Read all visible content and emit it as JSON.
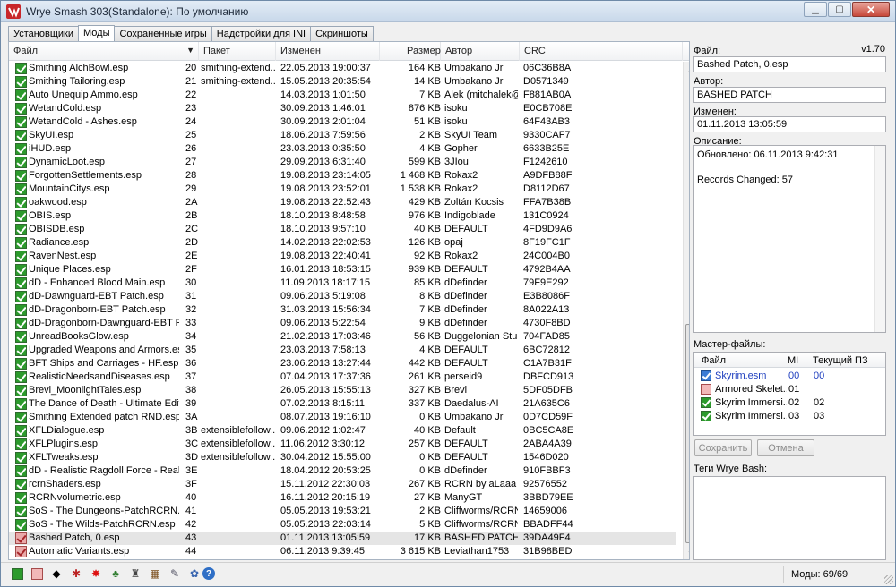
{
  "window": {
    "title": "Wrye Smash 303(Standalone): По умолчанию"
  },
  "tabs": [
    {
      "label": "Установщики",
      "active": false
    },
    {
      "label": "Моды",
      "active": true
    },
    {
      "label": "Сохраненные игры",
      "active": false
    },
    {
      "label": "Надстройки для INI",
      "active": false
    },
    {
      "label": "Скриншоты",
      "active": false
    }
  ],
  "mod_list": {
    "columns": {
      "file": "Файл",
      "package": "Пакет",
      "modified": "Изменен",
      "size": "Размер",
      "author": "Автор",
      "crc": "CRC"
    },
    "rows": [
      {
        "file": "Smithing AlchBowl.esp",
        "idx": "20",
        "package": "smithing-extend...",
        "date": "22.05.2013 19:00:37",
        "size": "164 KB",
        "author": "Umbakano Jr",
        "crc": "06C36B8A",
        "check": "on",
        "selected": false
      },
      {
        "file": "Smithing Tailoring.esp",
        "idx": "21",
        "package": "smithing-extend...",
        "date": "15.05.2013 20:35:54",
        "size": "14 KB",
        "author": "Umbakano Jr",
        "crc": "D0571349",
        "check": "on",
        "selected": false
      },
      {
        "file": "Auto Unequip Ammo.esp",
        "idx": "22",
        "package": "",
        "date": "14.03.2013 1:01:50",
        "size": "7 KB",
        "author": "Alek (mitchalek@...",
        "crc": "F881AB0A",
        "check": "on",
        "selected": false
      },
      {
        "file": "WetandCold.esp",
        "idx": "23",
        "package": "",
        "date": "30.09.2013 1:46:01",
        "size": "876 KB",
        "author": "isoku",
        "crc": "E0CB708E",
        "check": "on",
        "selected": false
      },
      {
        "file": "WetandCold - Ashes.esp",
        "idx": "24",
        "package": "",
        "date": "30.09.2013 2:01:04",
        "size": "51 KB",
        "author": "isoku",
        "crc": "64F43AB3",
        "check": "on",
        "selected": false
      },
      {
        "file": "SkyUI.esp",
        "idx": "25",
        "package": "",
        "date": "18.06.2013 7:59:56",
        "size": "2 KB",
        "author": "SkyUI Team",
        "crc": "9330CAF7",
        "check": "on",
        "selected": false
      },
      {
        "file": "iHUD.esp",
        "idx": "26",
        "package": "",
        "date": "23.03.2013 0:35:50",
        "size": "4 KB",
        "author": "Gopher",
        "crc": "6633B25E",
        "check": "on",
        "selected": false
      },
      {
        "file": "DynamicLoot.esp",
        "idx": "27",
        "package": "",
        "date": "29.09.2013 6:31:40",
        "size": "599 KB",
        "author": "3JIou",
        "crc": "F1242610",
        "check": "on",
        "selected": false
      },
      {
        "file": "ForgottenSettlements.esp",
        "idx": "28",
        "package": "",
        "date": "19.08.2013 23:14:05",
        "size": "1 468 KB",
        "author": "Rokax2",
        "crc": "A9DFB88F",
        "check": "on",
        "selected": false
      },
      {
        "file": "MountainCitys.esp",
        "idx": "29",
        "package": "",
        "date": "19.08.2013 23:52:01",
        "size": "1 538 KB",
        "author": "Rokax2",
        "crc": "D8112D67",
        "check": "on",
        "selected": false
      },
      {
        "file": "oakwood.esp",
        "idx": "2A",
        "package": "",
        "date": "19.08.2013 22:52:43",
        "size": "429 KB",
        "author": "Zoltán Kocsis",
        "crc": "FFA7B38B",
        "check": "on",
        "selected": false
      },
      {
        "file": "OBIS.esp",
        "idx": "2B",
        "package": "",
        "date": "18.10.2013 8:48:58",
        "size": "976 KB",
        "author": "Indigoblade",
        "crc": "131C0924",
        "check": "on",
        "selected": false
      },
      {
        "file": "OBISDB.esp",
        "idx": "2C",
        "package": "",
        "date": "18.10.2013 9:57:10",
        "size": "40 KB",
        "author": "DEFAULT",
        "crc": "4FD9D9A6",
        "check": "on",
        "selected": false
      },
      {
        "file": "Radiance.esp",
        "idx": "2D",
        "package": "",
        "date": "14.02.2013 22:02:53",
        "size": "126 KB",
        "author": "opaj",
        "crc": "8F19FC1F",
        "check": "on",
        "selected": false
      },
      {
        "file": "RavenNest.esp",
        "idx": "2E",
        "package": "",
        "date": "19.08.2013 22:40:41",
        "size": "92 KB",
        "author": "Rokax2",
        "crc": "24C004B0",
        "check": "on",
        "selected": false
      },
      {
        "file": "Unique Places.esp",
        "idx": "2F",
        "package": "",
        "date": "16.01.2013 18:53:15",
        "size": "939 KB",
        "author": "DEFAULT",
        "crc": "4792B4AA",
        "check": "on",
        "selected": false
      },
      {
        "file": "dD - Enhanced Blood Main.esp",
        "idx": "30",
        "package": "",
        "date": "11.09.2013 18:17:15",
        "size": "85 KB",
        "author": "dDefinder",
        "crc": "79F9E292",
        "check": "on",
        "selected": false
      },
      {
        "file": "dD-Dawnguard-EBT Patch.esp",
        "idx": "31",
        "package": "",
        "date": "09.06.2013 5:19:08",
        "size": "8 KB",
        "author": "dDefinder",
        "crc": "E3B8086F",
        "check": "on",
        "selected": false
      },
      {
        "file": "dD-Dragonborn-EBT Patch.esp",
        "idx": "32",
        "package": "",
        "date": "31.03.2013 15:56:34",
        "size": "7 KB",
        "author": "dDefinder",
        "crc": "8A022A13",
        "check": "on",
        "selected": false
      },
      {
        "file": "dD-Dragonborn-Dawnguard-EBT P...",
        "idx": "33",
        "package": "",
        "date": "09.06.2013 5:22:54",
        "size": "9 KB",
        "author": "dDefinder",
        "crc": "4730F8BD",
        "check": "on",
        "selected": false
      },
      {
        "file": "UnreadBooksGlow.esp",
        "idx": "34",
        "package": "",
        "date": "21.02.2013 17:03:46",
        "size": "56 KB",
        "author": "Duggelonian Stu...",
        "crc": "704FAD85",
        "check": "on",
        "selected": false
      },
      {
        "file": "Upgraded Weapons and Armors.esp",
        "idx": "35",
        "package": "",
        "date": "23.03.2013 7:58:13",
        "size": "4 KB",
        "author": "DEFAULT",
        "crc": "6BC72812",
        "check": "on",
        "selected": false
      },
      {
        "file": "BFT Ships and Carriages - HF.esp",
        "idx": "36",
        "package": "",
        "date": "23.06.2013 13:27:44",
        "size": "442 KB",
        "author": "DEFAULT",
        "crc": "C1A7B31F",
        "check": "on",
        "selected": false
      },
      {
        "file": "RealisticNeedsandDiseases.esp",
        "idx": "37",
        "package": "",
        "date": "07.04.2013 17:37:36",
        "size": "261 KB",
        "author": "perseid9",
        "crc": "DBFCD913",
        "check": "on",
        "selected": false
      },
      {
        "file": "Brevi_MoonlightTales.esp",
        "idx": "38",
        "package": "",
        "date": "26.05.2013 15:55:13",
        "size": "327 KB",
        "author": "Brevi",
        "crc": "5DF05DFB",
        "check": "on",
        "selected": false
      },
      {
        "file": "The Dance of Death - Ultimate Edit...",
        "idx": "39",
        "package": "",
        "date": "07.02.2013 8:15:11",
        "size": "337 KB",
        "author": "Daedalus-AI",
        "crc": "21A635C6",
        "check": "on",
        "selected": false
      },
      {
        "file": "Smithing Extended patch RND.esp",
        "idx": "3A",
        "package": "",
        "date": "08.07.2013 19:16:10",
        "size": "0 KB",
        "author": "Umbakano Jr",
        "crc": "0D7CD59F",
        "check": "on",
        "selected": false
      },
      {
        "file": "XFLDialogue.esp",
        "idx": "3B",
        "package": "extensiblefollow...",
        "date": "09.06.2012 1:02:47",
        "size": "40 KB",
        "author": "Default",
        "crc": "0BC5CA8E",
        "check": "on",
        "selected": false
      },
      {
        "file": "XFLPlugins.esp",
        "idx": "3C",
        "package": "extensiblefollow...",
        "date": "11.06.2012 3:30:12",
        "size": "257 KB",
        "author": "DEFAULT",
        "crc": "2ABA4A39",
        "check": "on",
        "selected": false
      },
      {
        "file": "XFLTweaks.esp",
        "idx": "3D",
        "package": "extensiblefollow...",
        "date": "30.04.2012 15:55:00",
        "size": "0 KB",
        "author": "DEFAULT",
        "crc": "1546D020",
        "check": "on",
        "selected": false
      },
      {
        "file": "dD - Realistic Ragdoll Force - Reali...",
        "idx": "3E",
        "package": "",
        "date": "18.04.2012 20:53:25",
        "size": "0 KB",
        "author": "dDefinder",
        "crc": "910FBBF3",
        "check": "on",
        "selected": false
      },
      {
        "file": "rcrnShaders.esp",
        "idx": "3F",
        "package": "",
        "date": "15.11.2012 22:30:03",
        "size": "267 KB",
        "author": "RCRN by aLaaa",
        "crc": "92576552",
        "check": "on",
        "selected": false
      },
      {
        "file": "RCRNvolumetric.esp",
        "idx": "40",
        "package": "",
        "date": "16.11.2012 20:15:19",
        "size": "27 KB",
        "author": "ManyGT",
        "crc": "3BBD79EE",
        "check": "on",
        "selected": false
      },
      {
        "file": "SoS - The Dungeons-PatchRCRN.esp",
        "idx": "41",
        "package": "",
        "date": "05.05.2013 19:53:21",
        "size": "2 KB",
        "author": "Cliffworms/RCRN...",
        "crc": "14659006",
        "check": "on",
        "selected": false
      },
      {
        "file": "SoS - The Wilds-PatchRCRN.esp",
        "idx": "42",
        "package": "",
        "date": "05.05.2013 22:03:14",
        "size": "5 KB",
        "author": "Cliffworms/RCRN...",
        "crc": "BBADFF44",
        "check": "on",
        "selected": false
      },
      {
        "file": "Bashed Patch, 0.esp",
        "idx": "43",
        "package": "",
        "date": "01.11.2013 13:05:59",
        "size": "17 KB",
        "author": "BASHED PATCH",
        "crc": "39DA49F4",
        "check": "red",
        "selected": true
      },
      {
        "file": "Automatic Variants.esp",
        "idx": "44",
        "package": "",
        "date": "06.11.2013 9:39:45",
        "size": "3 615 KB",
        "author": "Leviathan1753",
        "crc": "31B98BED",
        "check": "red",
        "selected": false
      }
    ]
  },
  "details": {
    "file_label": "Файл:",
    "version": "v1.70",
    "file_value": "Bashed Patch, 0.esp",
    "author_label": "Автор:",
    "author_value": "BASHED PATCH",
    "modified_label": "Изменен:",
    "modified_value": "01.11.2013 13:05:59",
    "description_label": "Описание:",
    "description_lines": [
      "Обновлено: 06.11.2013 9:42:31",
      "",
      "Records Changed: 57"
    ],
    "masters_label": "Мастер-файлы:",
    "masters_columns": {
      "file": "Файл",
      "mi": "MI",
      "current": "Текущий ПЗ"
    },
    "masters": [
      {
        "file": "Skyrim.esm",
        "mi": "00",
        "current": "00",
        "check": "blue"
      },
      {
        "file": "Armored Skelet...",
        "mi": "01",
        "current": "",
        "check": "empty"
      },
      {
        "file": "Skyrim Immersi...",
        "mi": "02",
        "current": "02",
        "check": "on"
      },
      {
        "file": "Skyrim Immersi...",
        "mi": "03",
        "current": "03",
        "check": "on"
      }
    ],
    "save_label": "Сохранить",
    "cancel_label": "Отмена",
    "tags_label": "Теги Wrye Bash:"
  },
  "statusbar": {
    "mods_count": "Моды: 69/69"
  }
}
